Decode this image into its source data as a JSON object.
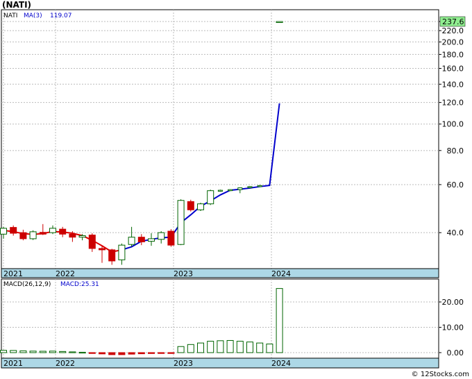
{
  "title": "(NATI)",
  "credit": "© 12Stocks.com",
  "colors": {
    "up": "#006400",
    "down": "#cc0000",
    "ma_recent": "#0000cc",
    "ma_early": "#dd0000",
    "axis_band": "#add8e6",
    "price_badge": "#90ee90"
  },
  "chart_data": [
    {
      "type": "candlestick",
      "symbol": "NATI",
      "ma_label": "MA(3)",
      "ma_value_text": "119.07",
      "last_price_text": "237.6",
      "y_scale": "log",
      "ylim": [
        30,
        260
      ],
      "yticks": [
        40.0,
        60.0,
        80.0,
        100.0,
        120.0,
        140.0,
        160.0,
        180.0,
        200.0,
        220.0,
        237.6
      ],
      "ytick_labels": [
        "40.0",
        "60.0",
        "80.0",
        "100.0",
        "120.0",
        "140.0",
        "160.0",
        "180.0",
        "200.0",
        "220.0",
        "237.6"
      ],
      "x_labels": [
        "2021",
        "2022",
        "2023",
        "2024"
      ],
      "x_label_months": [
        0,
        12,
        24,
        36
      ],
      "grid": true,
      "candles": [
        {
          "m": 0,
          "o": 39.5,
          "h": 42.0,
          "l": 38.0,
          "c": 41.5
        },
        {
          "m": 1,
          "o": 41.8,
          "h": 42.5,
          "l": 39.0,
          "c": 39.8
        },
        {
          "m": 2,
          "o": 40.0,
          "h": 41.0,
          "l": 37.5,
          "c": 38.0
        },
        {
          "m": 3,
          "o": 38.0,
          "h": 40.8,
          "l": 37.6,
          "c": 40.3
        },
        {
          "m": 4,
          "o": 40.1,
          "h": 43.0,
          "l": 39.2,
          "c": 39.5
        },
        {
          "m": 5,
          "o": 40.0,
          "h": 42.5,
          "l": 39.5,
          "c": 41.5
        },
        {
          "m": 6,
          "o": 41.2,
          "h": 42.0,
          "l": 38.5,
          "c": 39.5
        },
        {
          "m": 7,
          "o": 39.5,
          "h": 40.5,
          "l": 37.0,
          "c": 38.5
        },
        {
          "m": 8,
          "o": 38.5,
          "h": 39.5,
          "l": 37.5,
          "c": 39.0
        },
        {
          "m": 9,
          "o": 39.2,
          "h": 39.8,
          "l": 34.0,
          "c": 35.0
        },
        {
          "m": 10,
          "o": 35.0,
          "h": 35.8,
          "l": 31.0,
          "c": 34.6
        },
        {
          "m": 11,
          "o": 34.6,
          "h": 34.9,
          "l": 30.5,
          "c": 31.5
        },
        {
          "m": 12,
          "o": 31.8,
          "h": 36.5,
          "l": 30.5,
          "c": 36.0
        },
        {
          "m": 13,
          "o": 36.2,
          "h": 42.0,
          "l": 35.5,
          "c": 38.5
        },
        {
          "m": 14,
          "o": 38.5,
          "h": 39.5,
          "l": 36.0,
          "c": 37.0
        },
        {
          "m": 15,
          "o": 37.2,
          "h": 39.8,
          "l": 35.8,
          "c": 38.0
        },
        {
          "m": 16,
          "o": 37.8,
          "h": 40.5,
          "l": 36.5,
          "c": 40.0
        },
        {
          "m": 17,
          "o": 40.5,
          "h": 41.2,
          "l": 35.5,
          "c": 36.0
        },
        {
          "m": 18,
          "o": 36.2,
          "h": 53.0,
          "l": 36.0,
          "c": 52.5
        },
        {
          "m": 19,
          "o": 52.0,
          "h": 52.8,
          "l": 47.8,
          "c": 48.5
        },
        {
          "m": 20,
          "o": 48.5,
          "h": 51.5,
          "l": 48.0,
          "c": 51.0
        },
        {
          "m": 21,
          "o": 51.0,
          "h": 57.5,
          "l": 50.5,
          "c": 57.0
        },
        {
          "m": 22,
          "o": 57.0,
          "h": 57.5,
          "l": 56.5,
          "c": 57.2
        },
        {
          "m": 23,
          "o": 57.2,
          "h": 57.7,
          "l": 56.8,
          "c": 57.5
        },
        {
          "m": 24,
          "o": 57.5,
          "h": 58.6,
          "l": 55.8,
          "c": 58.4
        },
        {
          "m": 25,
          "o": 58.5,
          "h": 59.3,
          "l": 58.2,
          "c": 59.0
        },
        {
          "m": 26,
          "o": 59.2,
          "h": 59.8,
          "l": 59.0,
          "c": 59.5
        },
        {
          "m": 28,
          "o": 237.0,
          "h": 237.8,
          "l": 236.2,
          "c": 237.6
        }
      ],
      "ma": [
        {
          "m": 0,
          "v": 40.8
        },
        {
          "m": 1,
          "v": 40.3
        },
        {
          "m": 2,
          "v": 39.7
        },
        {
          "m": 3,
          "v": 39.4
        },
        {
          "m": 4,
          "v": 39.7
        },
        {
          "m": 5,
          "v": 40.4
        },
        {
          "m": 6,
          "v": 40.2
        },
        {
          "m": 7,
          "v": 39.8
        },
        {
          "m": 8,
          "v": 39.0
        },
        {
          "m": 9,
          "v": 37.5
        },
        {
          "m": 10,
          "v": 35.8
        },
        {
          "m": 11,
          "v": 34.0
        },
        {
          "m": 12,
          "v": 34.6
        },
        {
          "m": 13,
          "v": 35.5
        },
        {
          "m": 14,
          "v": 37.2
        },
        {
          "m": 15,
          "v": 37.8
        },
        {
          "m": 16,
          "v": 38.3
        },
        {
          "m": 17,
          "v": 38.5
        },
        {
          "m": 18,
          "v": 43.5
        },
        {
          "m": 19,
          "v": 46.5
        },
        {
          "m": 20,
          "v": 50.0
        },
        {
          "m": 21,
          "v": 52.3
        },
        {
          "m": 22,
          "v": 55.0
        },
        {
          "m": 23,
          "v": 57.2
        },
        {
          "m": 24,
          "v": 57.7
        },
        {
          "m": 25,
          "v": 58.3
        },
        {
          "m": 26,
          "v": 59.0
        },
        {
          "m": 27,
          "v": 59.6
        },
        {
          "m": 28,
          "v": 119.07
        }
      ]
    },
    {
      "type": "bar",
      "label": "MACD(26,12,9)",
      "value_label": "MACD:25.31",
      "ylim": [
        -2,
        28
      ],
      "yticks": [
        0.0,
        10.0,
        20.0
      ],
      "ytick_labels": [
        "0.00",
        "10.00",
        "20.00"
      ],
      "x_labels": [
        "2021",
        "2022",
        "2023",
        "2024"
      ],
      "x_label_months": [
        0,
        12,
        24,
        36
      ],
      "grid": true,
      "bars": [
        {
          "m": 0,
          "v": 0.9
        },
        {
          "m": 1,
          "v": 0.85
        },
        {
          "m": 2,
          "v": 0.7
        },
        {
          "m": 3,
          "v": 0.6
        },
        {
          "m": 4,
          "v": 0.55
        },
        {
          "m": 5,
          "v": 0.6
        },
        {
          "m": 6,
          "v": 0.45
        },
        {
          "m": 7,
          "v": 0.3
        },
        {
          "m": 8,
          "v": 0.15
        },
        {
          "m": 9,
          "v": -0.2
        },
        {
          "m": 10,
          "v": -0.5
        },
        {
          "m": 11,
          "v": -0.8
        },
        {
          "m": 12,
          "v": -0.8
        },
        {
          "m": 13,
          "v": -0.6
        },
        {
          "m": 14,
          "v": -0.45
        },
        {
          "m": 15,
          "v": -0.35
        },
        {
          "m": 16,
          "v": -0.2
        },
        {
          "m": 17,
          "v": -0.1
        },
        {
          "m": 18,
          "v": 2.4
        },
        {
          "m": 19,
          "v": 3.2
        },
        {
          "m": 20,
          "v": 3.8
        },
        {
          "m": 21,
          "v": 4.5
        },
        {
          "m": 22,
          "v": 4.7
        },
        {
          "m": 23,
          "v": 4.8
        },
        {
          "m": 24,
          "v": 4.5
        },
        {
          "m": 25,
          "v": 4.2
        },
        {
          "m": 26,
          "v": 3.8
        },
        {
          "m": 27,
          "v": 3.4
        },
        {
          "m": 28,
          "v": 25.31
        }
      ]
    }
  ]
}
